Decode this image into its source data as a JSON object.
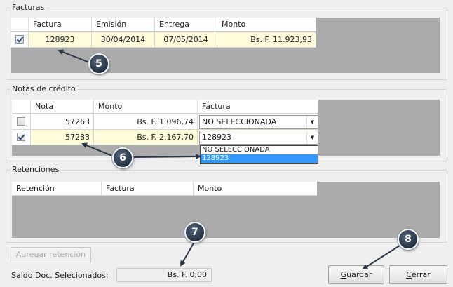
{
  "facturas": {
    "title": "Facturas",
    "columns": [
      "Factura",
      "Emisión",
      "Entrega",
      "Monto"
    ],
    "rows": [
      {
        "checked": true,
        "factura": "128923",
        "emision": "30/04/2014",
        "entrega": "07/05/2014",
        "monto": "Bs. F. 11.923,93"
      }
    ]
  },
  "notas": {
    "title": "Notas de crédito",
    "columns": [
      "Nota",
      "Monto",
      "Factura"
    ],
    "rows": [
      {
        "checked": false,
        "nota": "57263",
        "monto": "Bs. F. 1.096,74",
        "factura": "NO SELECCIONADA"
      },
      {
        "checked": true,
        "nota": "57283",
        "monto": "Bs. F. 2.167,70",
        "factura": "128923"
      }
    ],
    "dropdown_options": [
      "NO SELECCIONADA",
      "128923"
    ],
    "dropdown_selected": "128923"
  },
  "retenciones": {
    "title": "Retenciones",
    "columns": [
      "Retención",
      "Factura",
      "Monto"
    ]
  },
  "buttons": {
    "agregar": "Agregar retención",
    "guardar": "Guardar",
    "cerrar": "Cerrar"
  },
  "saldo": {
    "label": "Saldo Doc. Selecionados:",
    "value": "Bs. F. 0,00"
  },
  "annotations": [
    "5",
    "6",
    "7",
    "8"
  ],
  "colors": {
    "highlight_row": "#fffcdc",
    "selected_option": "#3399ff",
    "grid_background": "#ababab"
  }
}
